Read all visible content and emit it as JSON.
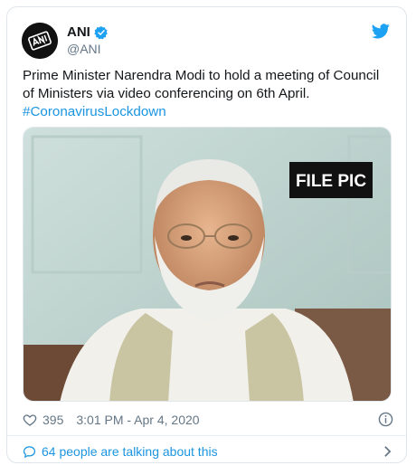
{
  "tweet": {
    "display_name": "ANI",
    "handle": "@ANI",
    "verified": true,
    "text": "Prime Minister Narendra Modi to hold a meeting of Council of Ministers via video conferencing on 6th April.",
    "hashtag": "#CoronavirusLockdown",
    "media": {
      "overlay_label": "FILE PIC"
    },
    "likes": "395",
    "timestamp": "3:01 PM - Apr 4, 2020",
    "talking": "64 people are talking about this"
  },
  "icons": {
    "verified": "verified-badge-icon",
    "bird": "twitter-bird-icon",
    "heart": "heart-icon",
    "info": "info-icon",
    "bubble": "speech-bubble-icon",
    "chevron": "chevron-right-icon"
  },
  "colors": {
    "accent": "#1b95e0",
    "text": "#14171a",
    "muted": "#657786"
  }
}
